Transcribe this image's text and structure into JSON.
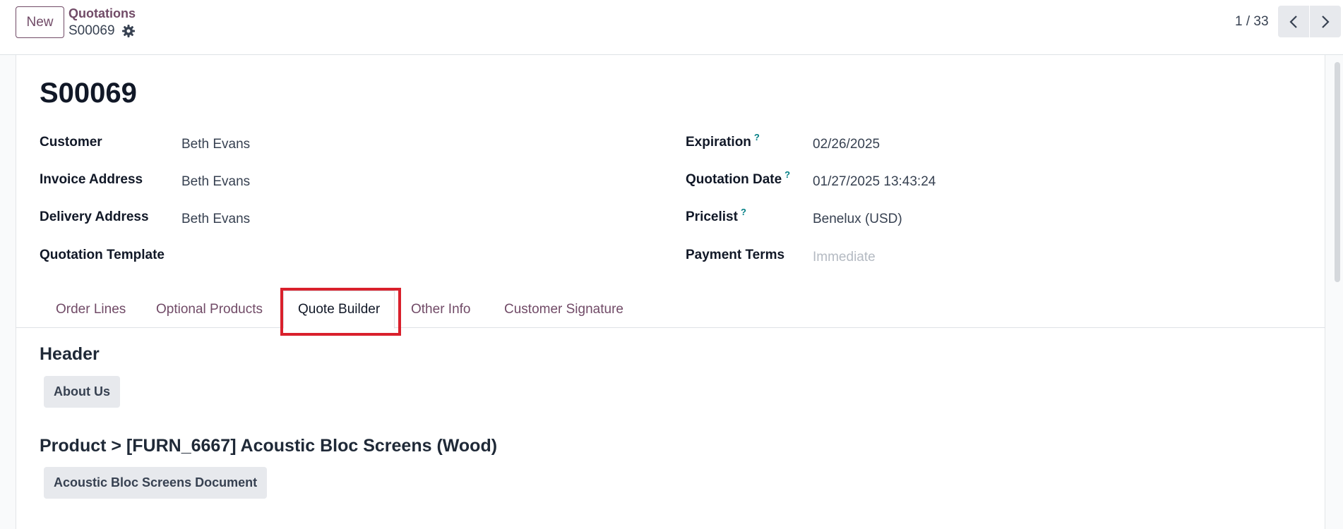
{
  "control_panel": {
    "new_label": "New",
    "breadcrumb_parent": "Quotations",
    "breadcrumb_current": "S00069",
    "pager_value": "1 / 33"
  },
  "form": {
    "title": "S00069",
    "left_fields": [
      {
        "label": "Customer",
        "value": "Beth Evans"
      },
      {
        "label": "Invoice Address",
        "value": "Beth Evans"
      },
      {
        "label": "Delivery Address",
        "value": "Beth Evans"
      },
      {
        "label": "Quotation Template",
        "value": ""
      }
    ],
    "right_fields": [
      {
        "label": "Expiration",
        "help": "?",
        "value": "02/26/2025"
      },
      {
        "label": "Quotation Date",
        "help": "?",
        "value": "01/27/2025 13:43:24"
      },
      {
        "label": "Pricelist",
        "help": "?",
        "value": "Benelux (USD)"
      },
      {
        "label": "Payment Terms",
        "help": "",
        "value": "Immediate"
      }
    ]
  },
  "tabs": [
    {
      "label": "Order Lines"
    },
    {
      "label": "Optional Products"
    },
    {
      "label": "Quote Builder",
      "active": true
    },
    {
      "label": "Other Info"
    },
    {
      "label": "Customer Signature"
    }
  ],
  "quote_builder": {
    "header_heading": "Header",
    "header_button": "About Us",
    "product_heading": "Product > [FURN_6667] Acoustic Bloc Screens (Wood)",
    "product_button": "Acoustic Bloc Screens Document"
  },
  "colors": {
    "brand": "#714b67",
    "highlight": "#d9202c",
    "help": "#017e84"
  }
}
